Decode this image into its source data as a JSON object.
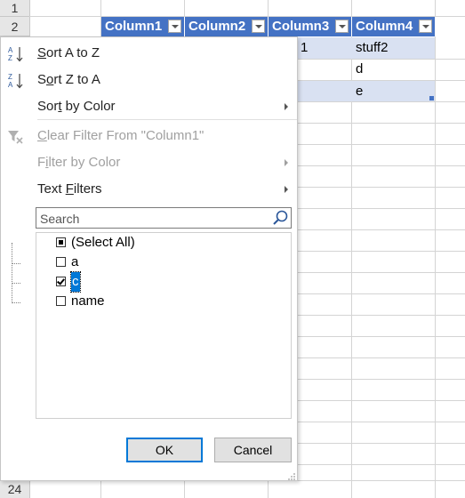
{
  "sheet": {
    "row_numbers": [
      "1",
      "2",
      "24"
    ],
    "columns": [
      "Column1",
      "Column2",
      "Column3",
      "Column4"
    ],
    "cells": {
      "r3_col3_partial": "1",
      "r3_col4": "stuff2",
      "r4_col4": "d",
      "r5_col4": "e"
    },
    "colors": {
      "header": "#4472c4",
      "band": "#d9e1f2"
    }
  },
  "menu": {
    "sort_az": {
      "pre": "",
      "u": "S",
      "post": "ort A to Z",
      "icon": "sort-ascending-icon"
    },
    "sort_za": {
      "pre": "S",
      "u": "o",
      "post": "rt Z to A",
      "icon": "sort-descending-icon"
    },
    "sort_color": {
      "pre": "Sor",
      "u": "t",
      "post": " by Color"
    },
    "clear_filter": {
      "pre": "",
      "u": "C",
      "post": "lear Filter From \"Column1\"",
      "icon": "clear-filter-icon"
    },
    "filter_color": {
      "pre": "F",
      "u": "i",
      "post": "lter by Color"
    },
    "text_filters": {
      "pre": "Text ",
      "u": "F",
      "post": "ilters"
    }
  },
  "search": {
    "placeholder": "Search",
    "icon": "search-icon"
  },
  "list": [
    {
      "label": "(Select All)",
      "state": "partial"
    },
    {
      "label": "a",
      "state": "unchecked"
    },
    {
      "label": "c",
      "state": "checked"
    },
    {
      "label": "name",
      "state": "unchecked"
    }
  ],
  "buttons": {
    "ok": "OK",
    "cancel": "Cancel"
  },
  "accent": "#0078d7"
}
